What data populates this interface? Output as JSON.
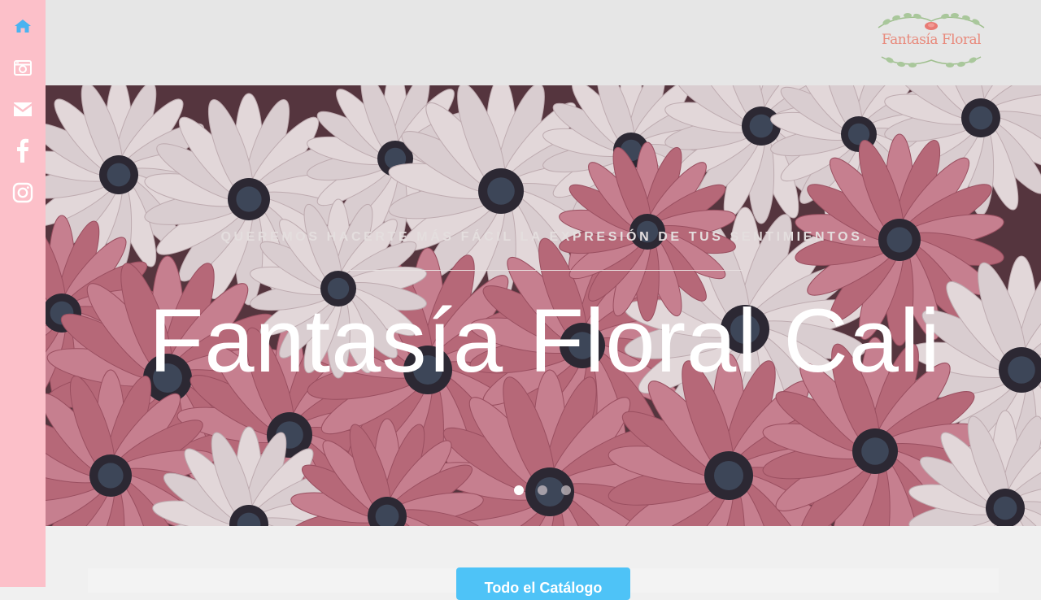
{
  "sidebar": {
    "items": [
      {
        "icon": "home-icon",
        "color": "#4ab3f0"
      },
      {
        "icon": "camera-icon",
        "color": "#ffffff"
      },
      {
        "icon": "envelope-icon",
        "color": "#ffffff"
      },
      {
        "icon": "facebook-icon",
        "color": "#ffffff"
      },
      {
        "icon": "instagram-icon",
        "color": "#ffffff"
      }
    ]
  },
  "header": {
    "logo_text": "Fantasía Floral"
  },
  "hero": {
    "subtitle": "QUEREMOS HACERTE MÁS FÁCIL LA EXPRESIÓN DE TUS SENTIMIENTOS.",
    "title": "Fantasía Floral Cali",
    "slides": {
      "total": 3,
      "active": 1
    }
  },
  "content": {
    "catalog_button": "Todo el Catálogo"
  },
  "colors": {
    "sidebar_bg": "#fcc0c9",
    "header_bg": "#e6e6e6",
    "accent_blue": "#4ec3f7",
    "active_icon": "#4ab3f0"
  }
}
